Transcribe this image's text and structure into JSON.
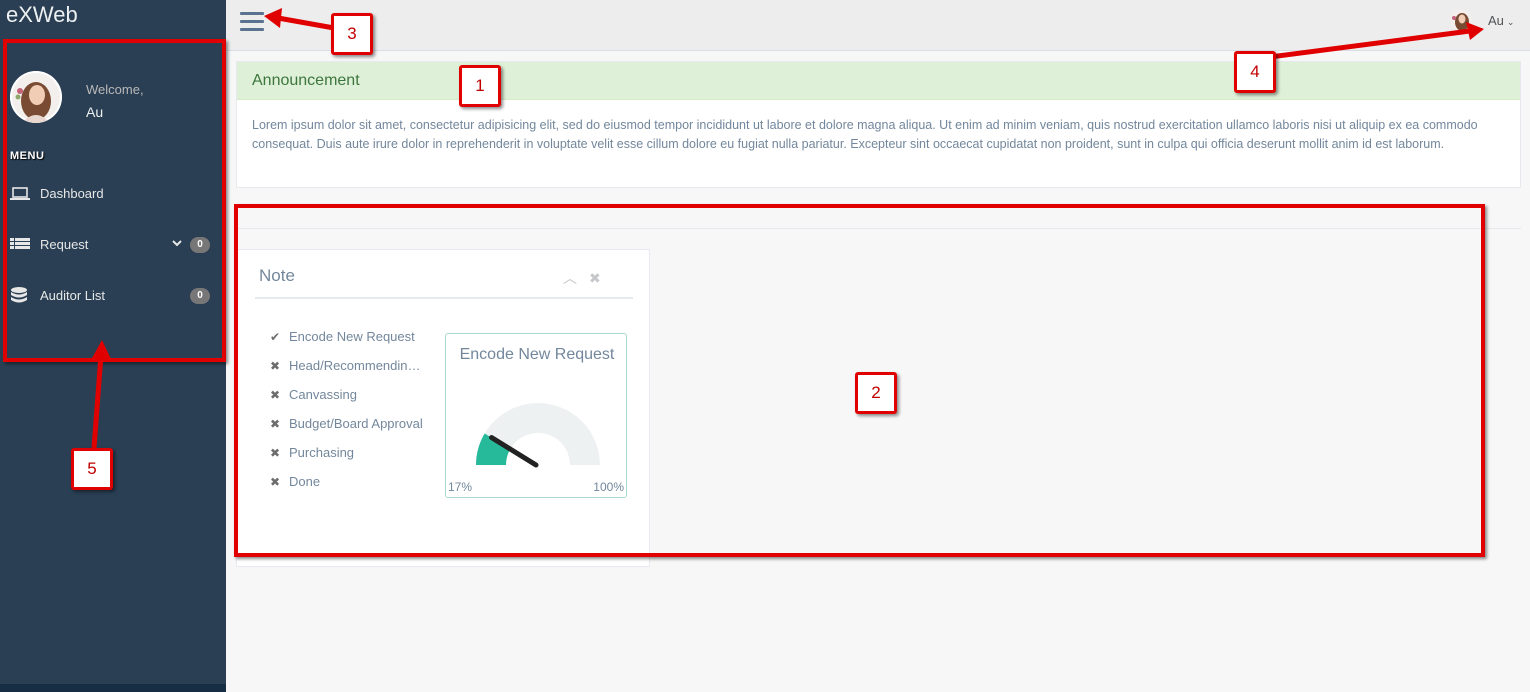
{
  "brand": "eXWeb",
  "sidebar": {
    "welcome": "Welcome,",
    "username": "Au",
    "menu_heading": "MENU",
    "items": [
      {
        "label": "Dashboard",
        "icon": "laptop-icon"
      },
      {
        "label": "Request",
        "icon": "table-list-icon",
        "badge": "0"
      },
      {
        "label": "Auditor List",
        "icon": "database-icon",
        "badge": "0"
      }
    ]
  },
  "topnav": {
    "user_label": "Au",
    "caret": "⌄"
  },
  "announcement": {
    "title": "Announcement",
    "body": "Lorem ipsum dolor sit amet, consectetur adipisicing elit, sed do eiusmod tempor incididunt ut labore et dolore magna aliqua. Ut enim ad minim veniam, quis nostrud exercitation ullamco laboris nisi ut aliquip ex ea commodo consequat. Duis aute irure dolor in reprehenderit in voluptate velit esse cillum dolore eu fugiat nulla pariatur. Excepteur sint occaecat cupidatat non proident, sunt in culpa qui officia deserunt mollit anim id est laborum."
  },
  "note": {
    "title": "Note",
    "tools": {
      "collapse": "︿",
      "close": "✖"
    },
    "steps": [
      {
        "label": "Encode New Request",
        "status": "done",
        "mark": "✔"
      },
      {
        "label": "Head/Recommending Approval",
        "status": "pending",
        "mark": "✖"
      },
      {
        "label": "Canvassing",
        "status": "pending",
        "mark": "✖"
      },
      {
        "label": "Budget/Board Approval",
        "status": "pending",
        "mark": "✖"
      },
      {
        "label": "Purchasing",
        "status": "pending",
        "mark": "✖"
      },
      {
        "label": "Done",
        "status": "pending",
        "mark": "✖"
      }
    ],
    "gauge": {
      "title": "Encode New Request",
      "min_label": "17%",
      "max_label": "100%",
      "value_fraction": 0.17,
      "fill_color": "#26b99a",
      "track_color": "#eef1f2"
    }
  },
  "annotations": [
    "1",
    "2",
    "3",
    "4",
    "5"
  ],
  "colors": {
    "sidebar": "#2a3f54",
    "annotation": "#e00000",
    "announcement_bg": "#dff0d8"
  }
}
